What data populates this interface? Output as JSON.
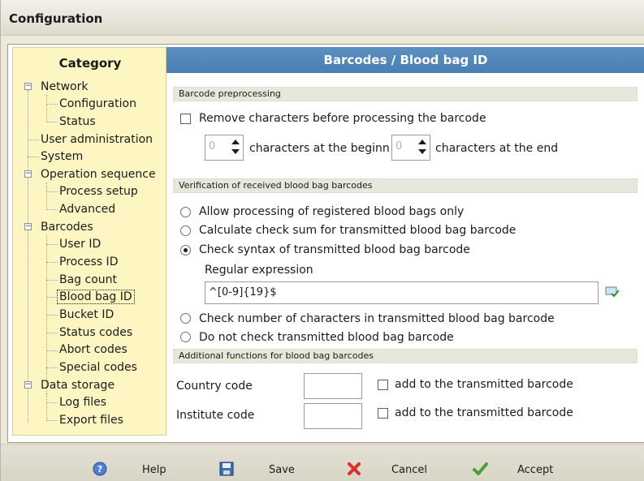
{
  "window": {
    "title": "Configuration"
  },
  "sidebar": {
    "title": "Category",
    "items": [
      {
        "label": "Network"
      },
      {
        "label": "Configuration"
      },
      {
        "label": "Status"
      },
      {
        "label": "User administration"
      },
      {
        "label": "System"
      },
      {
        "label": "Operation sequence"
      },
      {
        "label": "Process setup"
      },
      {
        "label": "Advanced"
      },
      {
        "label": "Barcodes"
      },
      {
        "label": "User ID"
      },
      {
        "label": "Process ID"
      },
      {
        "label": "Bag count"
      },
      {
        "label": "Blood bag ID"
      },
      {
        "label": "Bucket ID"
      },
      {
        "label": "Status codes"
      },
      {
        "label": "Abort codes"
      },
      {
        "label": "Special codes"
      },
      {
        "label": "Data storage"
      },
      {
        "label": "Log files"
      },
      {
        "label": "Export files"
      }
    ]
  },
  "main": {
    "header": "Barcodes / Blood bag ID",
    "preprocessing": {
      "section_title": "Barcode preprocessing",
      "remove_chars_label": "Remove characters before processing the barcode",
      "begin_value": "0",
      "begin_label": "characters at the beginn",
      "end_value": "0",
      "end_label": "characters at the end"
    },
    "verification": {
      "section_title": "Verification of received blood bag barcodes",
      "options": [
        {
          "label": "Allow processing of registered blood bags only"
        },
        {
          "label": "Calculate check sum for transmitted blood bag barcode"
        },
        {
          "label": "Check syntax of transmitted blood bag barcode"
        },
        {
          "label": "Check number of characters in transmitted blood bag barcode"
        },
        {
          "label": "Do not check transmitted blood bag barcode"
        }
      ],
      "regex_label": "Regular expression",
      "regex_value": "^[0-9]{19}$"
    },
    "additional": {
      "section_title": "Additional functions for blood bag barcodes",
      "country_label": "Country code",
      "country_value": "",
      "country_add_label": "add to the transmitted barcode",
      "institute_label": "Institute code",
      "institute_value": "",
      "institute_add_label": "add to the transmitted barcode"
    }
  },
  "footer": {
    "help": "Help",
    "save": "Save",
    "cancel": "Cancel",
    "accept": "Accept"
  }
}
